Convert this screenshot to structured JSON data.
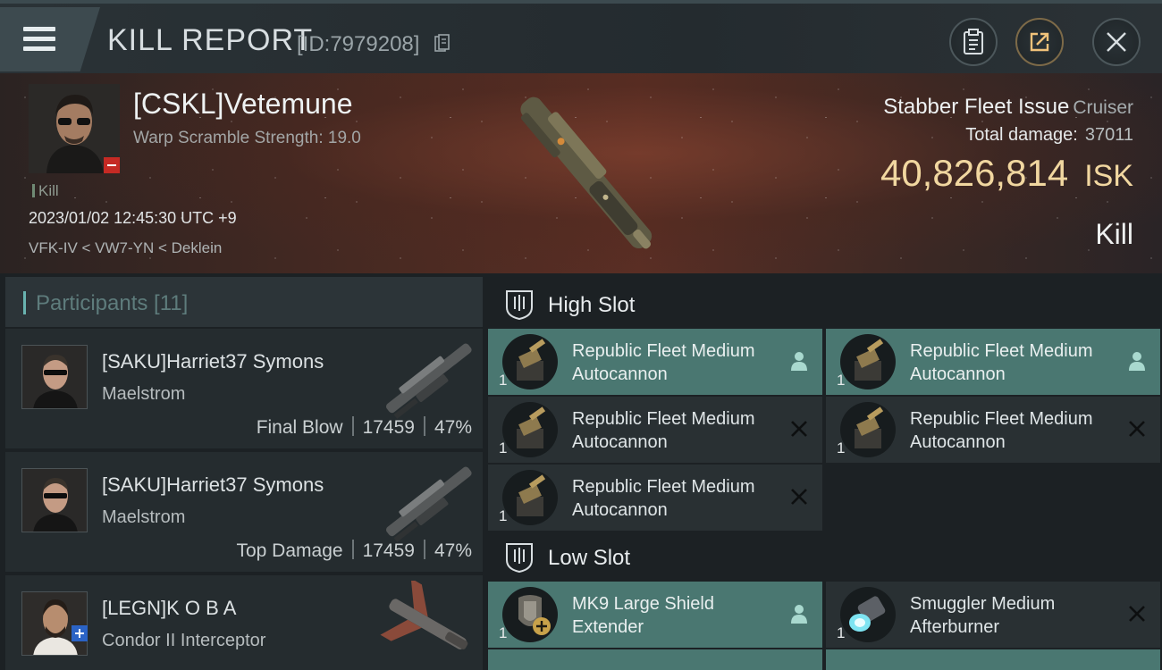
{
  "header": {
    "title": "KILL REPORT",
    "report_id": "[ID:7979208]"
  },
  "victim": {
    "name": "[CSKL]Vetemune",
    "scramble": "Warp Scramble Strength: 19.0",
    "kill_tag": "Kill",
    "datetime": "2023/01/02 12:45:30 UTC +9",
    "location": "VFK-IV < VW7-YN < Deklein",
    "ship": "Stabber Fleet Issue",
    "ship_class": "Cruiser",
    "damage_label": "Total damage:",
    "damage_value": "37011",
    "isk_value": "40,826,814",
    "isk_unit": "ISK",
    "kill_type": "Kill"
  },
  "participants": {
    "label": "Participants [11]",
    "items": [
      {
        "name": "[SAKU]Harriet37 Symons",
        "ship": "Maelstrom",
        "role": "Final Blow",
        "damage": "17459",
        "percent": "47%"
      },
      {
        "name": "[SAKU]Harriet37 Symons",
        "ship": "Maelstrom",
        "role": "Top Damage",
        "damage": "17459",
        "percent": "47%"
      },
      {
        "name": "[LEGN]K O B A",
        "ship": "Condor II Interceptor",
        "role": "",
        "damage": "",
        "percent": ""
      }
    ]
  },
  "slots": {
    "high": {
      "label": "High Slot",
      "modules": [
        {
          "name": "Republic Fleet Medium Autocannon",
          "qty": "1",
          "state": "person-icon"
        },
        {
          "name": "Republic Fleet Medium Autocannon",
          "qty": "1",
          "state": "person-icon"
        },
        {
          "name": "Republic Fleet Medium Autocannon",
          "qty": "1",
          "state": "destroyed-icon"
        },
        {
          "name": "Republic Fleet Medium Autocannon",
          "qty": "1",
          "state": "destroyed-icon"
        },
        {
          "name": "Republic Fleet Medium Autocannon",
          "qty": "1",
          "state": "destroyed-icon"
        }
      ]
    },
    "low": {
      "label": "Low Slot",
      "modules": [
        {
          "name": "MK9 Large Shield Extender",
          "qty": "1",
          "state": "person-icon"
        },
        {
          "name": "Smuggler Medium Afterburner",
          "qty": "1",
          "state": "destroyed-icon"
        }
      ]
    }
  },
  "colors": {
    "accent_teal": "#4a7771",
    "isk_gold": "#f1d7a0",
    "badge_red": "#c52a24",
    "badge_blue": "#2b63c5"
  }
}
